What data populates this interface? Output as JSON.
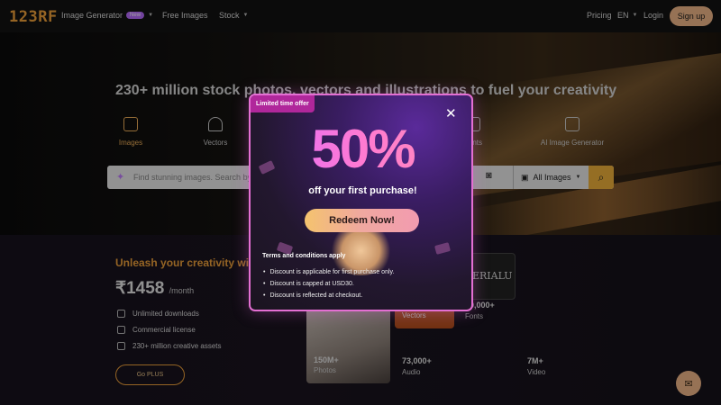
{
  "nav": {
    "logo": "123RF",
    "image_generator": "Image Generator",
    "new_badge": "New",
    "free_images": "Free Images",
    "stock": "Stock",
    "pricing": "Pricing",
    "language": "EN",
    "login": "Login",
    "signup": "Sign up"
  },
  "hero": {
    "title": "230+ million stock photos, vectors and illustrations to fuel your creativity",
    "categories": [
      {
        "label": "Images",
        "icon": "image-icon",
        "active": true
      },
      {
        "label": "Vectors",
        "icon": "pen-tool-icon"
      },
      {
        "label": "Fonts",
        "icon": "font-icon"
      },
      {
        "label": "AI Image Generator",
        "icon": "ai-sparkle-image-icon"
      }
    ],
    "search_placeholder": "Find stunning images. Search by keyword...",
    "search_filter": "All Images"
  },
  "plus": {
    "headline": "Unleash your creativity with PLUS",
    "price": "₹1458",
    "period": "/month",
    "features": [
      "Unlimited downloads",
      "Commercial license",
      "230+ million creative assets"
    ],
    "cta": "Go PLUS"
  },
  "stats": {
    "photos_num": "150M+",
    "photos_label": "Photos",
    "vectors_label": "Vectors",
    "fonts_num": "10,000+",
    "fonts_label": "Fonts",
    "audio_num": "73,000+",
    "audio_label": "Audio",
    "video_num": "7M+",
    "video_label": "Video",
    "fonts_tile_text": "ERIALU"
  },
  "modal": {
    "badge": "Limited time offer",
    "headline": "50%",
    "subheadline": "off your first purchase!",
    "cta": "Redeem Now!",
    "terms_title": "Terms and conditions apply",
    "terms": [
      "Discount is applicable for first purchase only.",
      "Discount is capped at USD30.",
      "Discount is reflected at checkout."
    ]
  },
  "colors": {
    "accent": "#f0a23b",
    "modal_border": "#e46fd3",
    "signup_bg": "#f2b98a"
  }
}
